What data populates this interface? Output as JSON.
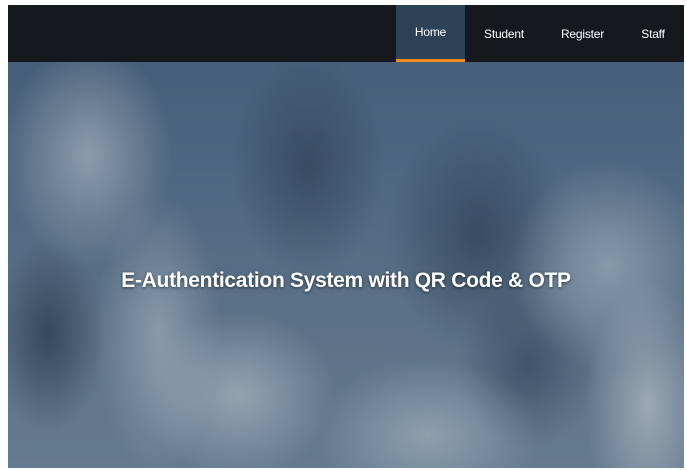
{
  "navbar": {
    "items": [
      {
        "label": "Home",
        "active": true
      },
      {
        "label": "Student",
        "active": false
      },
      {
        "label": "Register",
        "active": false
      },
      {
        "label": "Staff",
        "active": false
      }
    ]
  },
  "hero": {
    "title": "E-Authentication System with QR Code & OTP"
  },
  "colors": {
    "navbar_bg": "#15191d",
    "active_tab_bg": "#2c4257",
    "active_indicator": "#f08a1c",
    "hero_text": "#ffffff"
  }
}
